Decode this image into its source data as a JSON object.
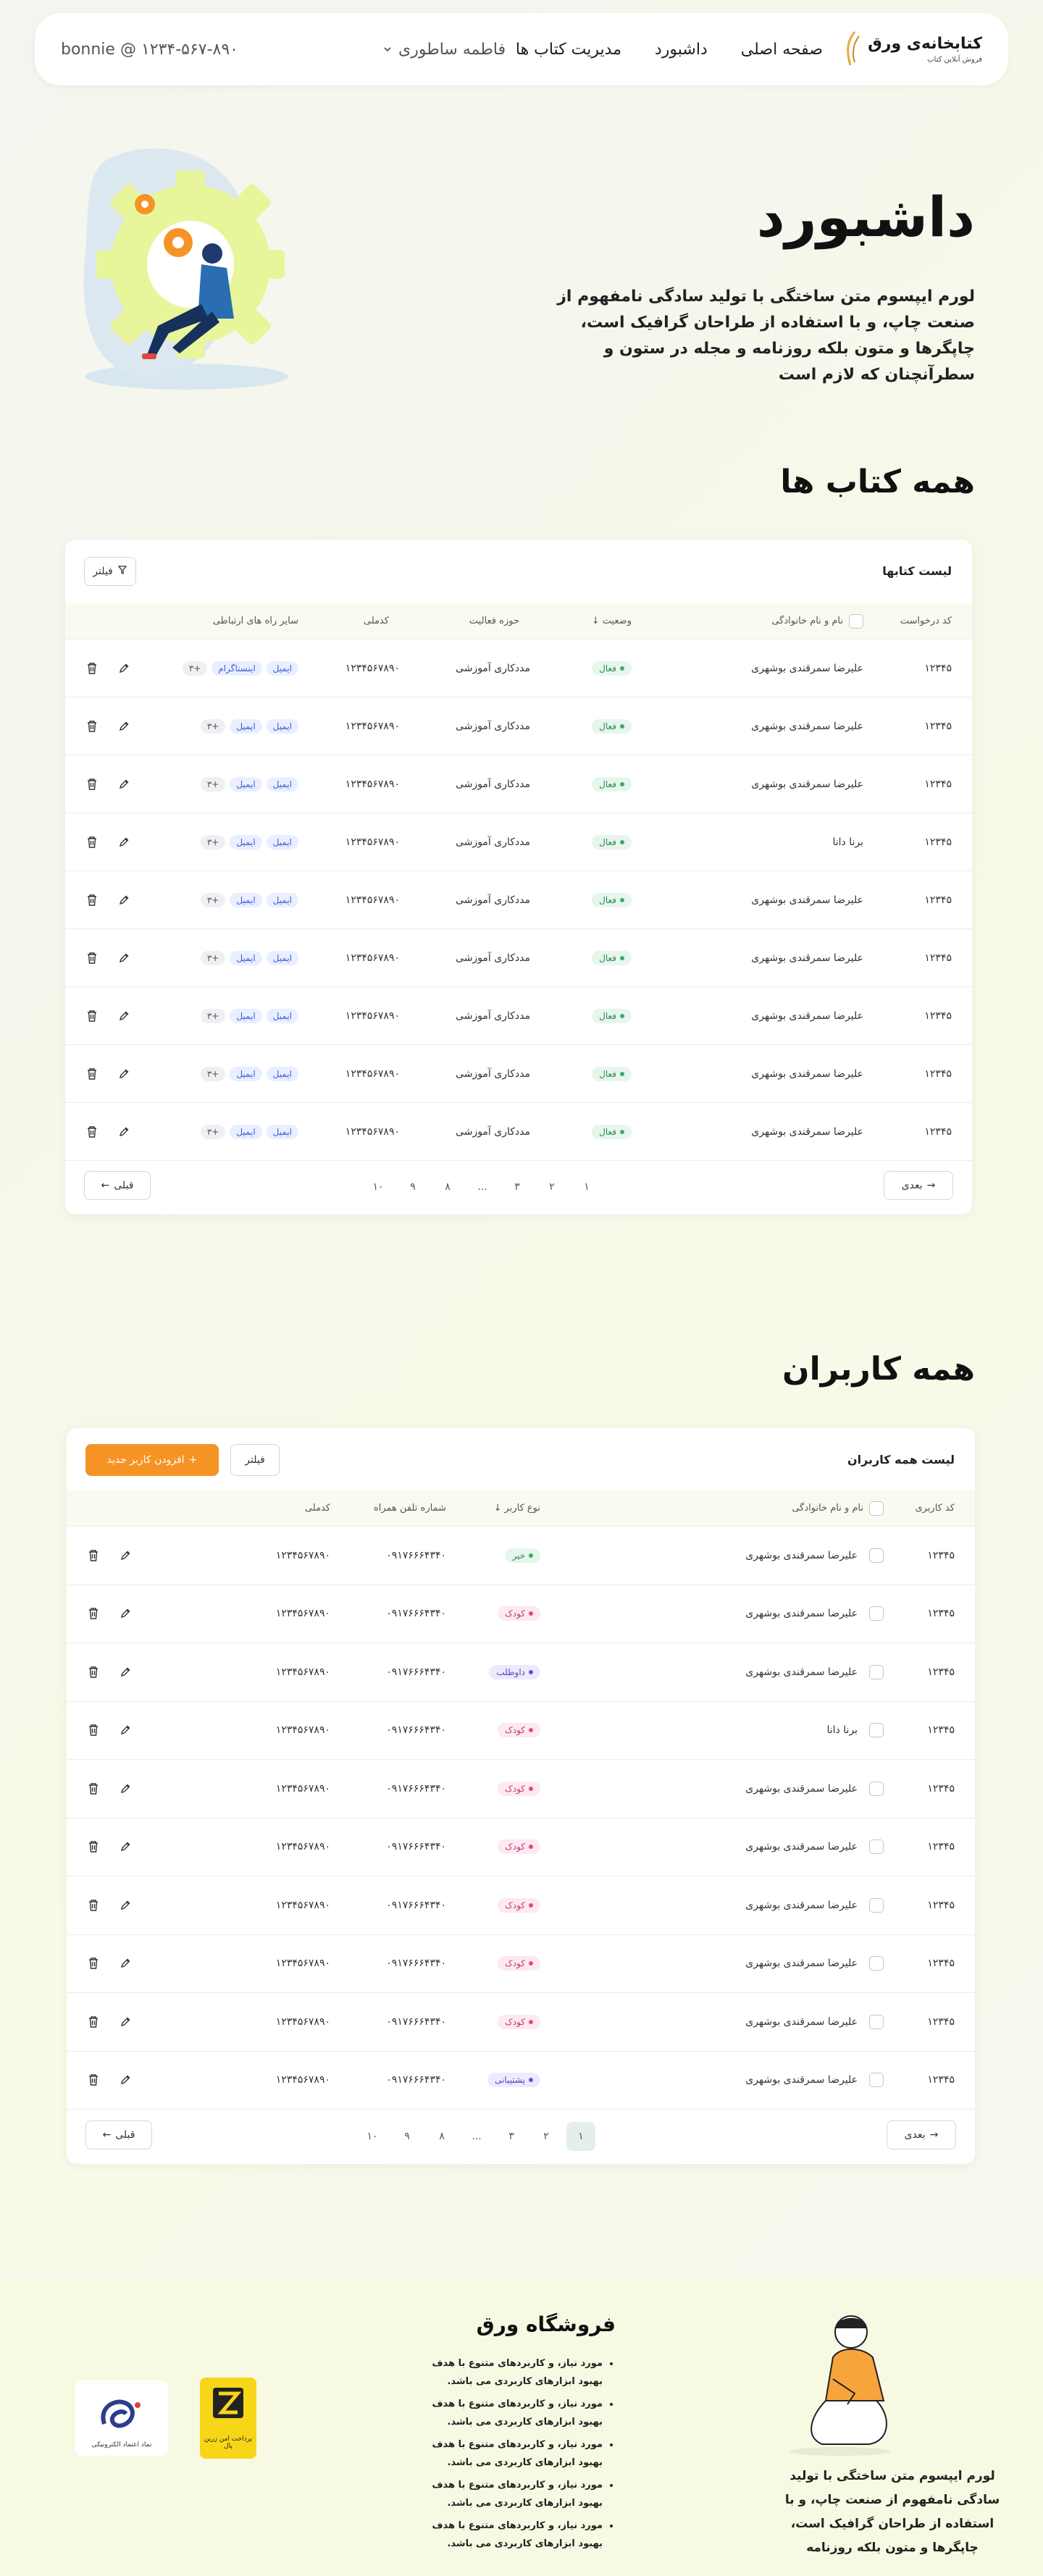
{
  "header": {
    "logo_title": "کتابخانه‌ی ورق",
    "logo_sub": "فروش آنلاین کتاب",
    "nav": [
      "صفحه اصلی",
      "داشبورد",
      "مدیریت کتاب ها"
    ],
    "user_name": "فاطمه ساطوری",
    "phone": "bonnie @ ۱۲۳۴-۵۶۷-۸۹۰"
  },
  "hero": {
    "title": "داشبورد",
    "text": "لورم ایپسوم متن ساختگی با تولید سادگی نامفهوم از صنعت چاپ، و با استفاده از طراحان گرافیک است، چاپگرها و متون بلکه روزنامه و مجله در ستون و سطرآنچنان که لازم است"
  },
  "books": {
    "section_title": "همه کتاب ها",
    "card_title": "لیست کتابها",
    "filter_label": "فیلتر",
    "columns": [
      "کد درخواست",
      "نام و نام خانوادگی",
      "وضعیت",
      "حوزه فعالیت",
      "کدملی",
      "سایر راه های ارتباطی"
    ],
    "rows": [
      {
        "code": "۱۲۳۴۵",
        "name": "علیرضا سمرقندی بوشهری",
        "status": "فعال",
        "field": "مددکاری آموزشی",
        "nid": "۱۲۳۴۵۶۷۸۹۰",
        "chips": [
          "ایمیل",
          "اینستاگرام",
          "+۳"
        ]
      },
      {
        "code": "۱۲۳۴۵",
        "name": "علیرضا سمرقندی بوشهری",
        "status": "فعال",
        "field": "مددکاری آموزشی",
        "nid": "۱۲۳۴۵۶۷۸۹۰",
        "chips": [
          "ایمیل",
          "ایمیل",
          "+۳"
        ]
      },
      {
        "code": "۱۲۳۴۵",
        "name": "علیرضا سمرقندی بوشهری",
        "status": "فعال",
        "field": "مددکاری آموزشی",
        "nid": "۱۲۳۴۵۶۷۸۹۰",
        "chips": [
          "ایمیل",
          "ایمیل",
          "+۳"
        ]
      },
      {
        "code": "۱۲۳۴۵",
        "name": "برنا دانا",
        "status": "فعال",
        "field": "مددکاری آموزشی",
        "nid": "۱۲۳۴۵۶۷۸۹۰",
        "chips": [
          "ایمیل",
          "ایمیل",
          "+۳"
        ]
      },
      {
        "code": "۱۲۳۴۵",
        "name": "علیرضا سمرقندی بوشهری",
        "status": "فعال",
        "field": "مددکاری آموزشی",
        "nid": "۱۲۳۴۵۶۷۸۹۰",
        "chips": [
          "ایمیل",
          "ایمیل",
          "+۳"
        ]
      },
      {
        "code": "۱۲۳۴۵",
        "name": "علیرضا سمرقندی بوشهری",
        "status": "فعال",
        "field": "مددکاری آموزشی",
        "nid": "۱۲۳۴۵۶۷۸۹۰",
        "chips": [
          "ایمیل",
          "ایمیل",
          "+۳"
        ]
      },
      {
        "code": "۱۲۳۴۵",
        "name": "علیرضا سمرقندی بوشهری",
        "status": "فعال",
        "field": "مددکاری آموزشی",
        "nid": "۱۲۳۴۵۶۷۸۹۰",
        "chips": [
          "ایمیل",
          "ایمیل",
          "+۳"
        ]
      },
      {
        "code": "۱۲۳۴۵",
        "name": "علیرضا سمرقندی بوشهری",
        "status": "فعال",
        "field": "مددکاری آموزشی",
        "nid": "۱۲۳۴۵۶۷۸۹۰",
        "chips": [
          "ایمیل",
          "ایمیل",
          "+۳"
        ]
      },
      {
        "code": "۱۲۳۴۵",
        "name": "علیرضا سمرقندی بوشهری",
        "status": "فعال",
        "field": "مددکاری آموزشی",
        "nid": "۱۲۳۴۵۶۷۸۹۰",
        "chips": [
          "ایمیل",
          "ایمیل",
          "+۳"
        ]
      }
    ],
    "pagination": {
      "next": "بعدی",
      "prev": "قبلی",
      "pages": [
        "۱",
        "۲",
        "۳",
        "...",
        "۸",
        "۹",
        "۱۰"
      ]
    }
  },
  "users": {
    "section_title": "همه کاربران",
    "card_title": "لیست همه کاربران",
    "filter_label": "فیلتر",
    "add_label": "افزودن کاربر جدید",
    "columns": [
      "کد کاربری",
      "نام و نام خانوادگی",
      "نوع کاربر",
      "شماره تلفن همراه",
      "کدملی"
    ],
    "rows": [
      {
        "code": "۱۲۳۴۵",
        "name": "علیرضا سمرقندی بوشهری",
        "type": "خیر",
        "kind": "green",
        "phone": "۰۹۱۷۶۶۶۴۳۴۰",
        "nid": "۱۲۳۴۵۶۷۸۹۰"
      },
      {
        "code": "۱۲۳۴۵",
        "name": "علیرضا سمرقندی بوشهری",
        "type": "کودک",
        "kind": "pink",
        "phone": "۰۹۱۷۶۶۶۴۳۴۰",
        "nid": "۱۲۳۴۵۶۷۸۹۰"
      },
      {
        "code": "۱۲۳۴۵",
        "name": "علیرضا سمرقندی بوشهری",
        "type": "داوطلب",
        "kind": "purple",
        "phone": "۰۹۱۷۶۶۶۴۳۴۰",
        "nid": "۱۲۳۴۵۶۷۸۹۰"
      },
      {
        "code": "۱۲۳۴۵",
        "name": "برنا دانا",
        "type": "کودک",
        "kind": "pink",
        "phone": "۰۹۱۷۶۶۶۴۳۴۰",
        "nid": "۱۲۳۴۵۶۷۸۹۰"
      },
      {
        "code": "۱۲۳۴۵",
        "name": "علیرضا سمرقندی بوشهری",
        "type": "کودک",
        "kind": "pink",
        "phone": "۰۹۱۷۶۶۶۴۳۴۰",
        "nid": "۱۲۳۴۵۶۷۸۹۰"
      },
      {
        "code": "۱۲۳۴۵",
        "name": "علیرضا سمرقندی بوشهری",
        "type": "کودک",
        "kind": "pink",
        "phone": "۰۹۱۷۶۶۶۴۳۴۰",
        "nid": "۱۲۳۴۵۶۷۸۹۰"
      },
      {
        "code": "۱۲۳۴۵",
        "name": "علیرضا سمرقندی بوشهری",
        "type": "کودک",
        "kind": "pink",
        "phone": "۰۹۱۷۶۶۶۴۳۴۰",
        "nid": "۱۲۳۴۵۶۷۸۹۰"
      },
      {
        "code": "۱۲۳۴۵",
        "name": "علیرضا سمرقندی بوشهری",
        "type": "کودک",
        "kind": "pink",
        "phone": "۰۹۱۷۶۶۶۴۳۴۰",
        "nid": "۱۲۳۴۵۶۷۸۹۰"
      },
      {
        "code": "۱۲۳۴۵",
        "name": "علیرضا سمرقندی بوشهری",
        "type": "کودک",
        "kind": "pink",
        "phone": "۰۹۱۷۶۶۶۴۳۴۰",
        "nid": "۱۲۳۴۵۶۷۸۹۰"
      },
      {
        "code": "۱۲۳۴۵",
        "name": "علیرضا سمرقندی بوشهری",
        "type": "پشتیبانی",
        "kind": "purple",
        "phone": "۰۹۱۷۶۶۶۴۳۴۰",
        "nid": "۱۲۳۴۵۶۷۸۹۰"
      }
    ],
    "pagination": {
      "next": "بعدی",
      "prev": "قبلی",
      "pages": [
        "۱",
        "۲",
        "۳",
        "...",
        "۸",
        "۹",
        "۱۰"
      ],
      "active": "۱"
    }
  },
  "footer": {
    "text": "لورم ایپسوم متن ساختگی با تولید سادگی نامفهوم از صنعت چاپ، و با استفاده از طراحان گرافیک است، چاپگرها و متون بلکه روزنامه",
    "title": "فروشگاه ورق",
    "items": [
      "مورد نیاز، و کاربردهای متنوع با هدف بهبود ابزارهای کاربردی می باشد.",
      "مورد نیاز، و کاربردهای متنوع با هدف بهبود ابزارهای کاربردی می باشد.",
      "مورد نیاز، و کاربردهای متنوع با هدف بهبود ابزارهای کاربردی می باشد.",
      "مورد نیاز، و کاربردهای متنوع با هدف بهبود ابزارهای کاربردی می باشد.",
      "مورد نیاز، و کاربردهای متنوع با هدف بهبود ابزارهای کاربردی می باشد."
    ],
    "zarinpal_label": "پرداخت امن زرین پال",
    "enamad_label": "نماد اعتماد الکترونیکی"
  },
  "colors": {
    "accent": "#f59324",
    "green": "#3ea86b",
    "pink": "#e2498a",
    "purple": "#6a4fd6"
  }
}
